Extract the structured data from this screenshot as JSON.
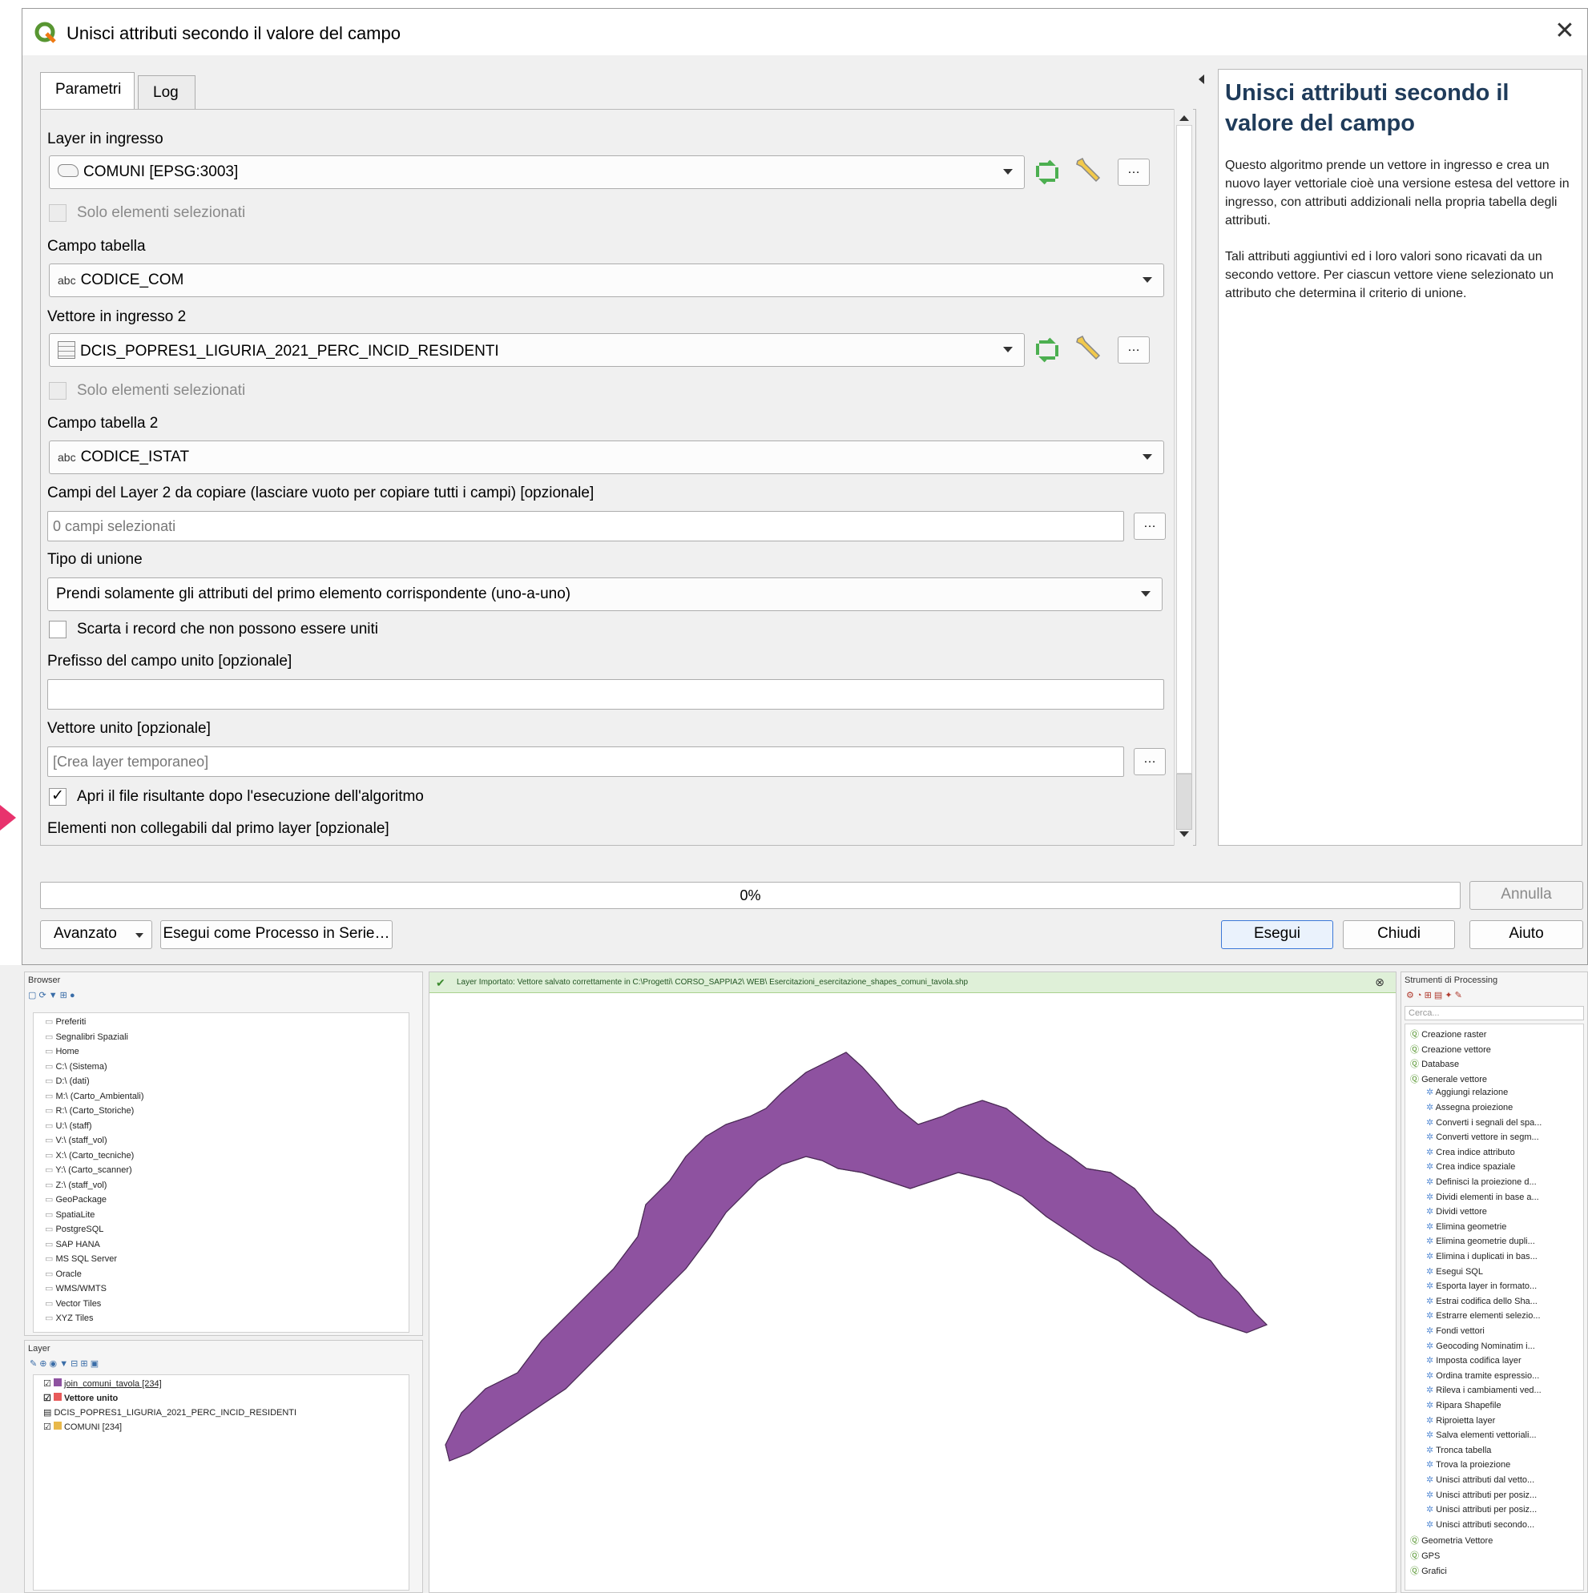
{
  "dialog": {
    "title": "Unisci attributi secondo il valore del campo",
    "close_glyph": "✕",
    "tabs": [
      "Parametri",
      "Log"
    ],
    "fields": {
      "input_layer_label": "Layer in ingresso",
      "input_layer_value": "COMUNI [EPSG:3003]",
      "selected_only_label": "Solo elementi selezionati",
      "table_field_label": "Campo tabella",
      "table_field_prefix": "abc",
      "table_field_value": "CODICE_COM",
      "input_layer2_label": "Vettore in ingresso 2",
      "input_layer2_value": "DCIS_POPRES1_LIGURIA_2021_PERC_INCID_RESIDENTI",
      "selected_only2_label": "Solo elementi selezionati",
      "table_field2_label": "Campo tabella 2",
      "table_field2_prefix": "abc",
      "table_field2_value": "CODICE_ISTAT",
      "fields_to_copy_label": "Campi del Layer 2 da copiare (lasciare vuoto per copiare tutti i campi) [opzionale]",
      "fields_to_copy_value": "0 campi selezionati",
      "join_type_label": "Tipo di unione",
      "join_type_value": "Prendi solamente gli attributi del primo elemento corrispondente (uno-a-uno)",
      "discard_label": "Scarta i record che non possono essere uniti",
      "prefix_label": "Prefisso del campo unito [opzionale]",
      "prefix_value": "",
      "joined_layer_label": "Vettore unito [opzionale]",
      "joined_layer_placeholder": "[Crea layer temporaneo]",
      "open_output_label": "Apri il file risultante dopo l'esecuzione dell'algoritmo",
      "open_output_checked": "✓",
      "unjoinable_label": "Elementi non collegabili dal primo layer [opzionale]",
      "ellipsis": "…"
    },
    "help": {
      "title": "Unisci attributi secondo il valore del campo",
      "p1": "Questo algoritmo prende un vettore in ingresso e crea un nuovo layer vettoriale cioè una versione estesa del vettore in ingresso, con attributi addizionali nella propria tabella degli attributi.",
      "p2": "Tali attributi aggiuntivi ed i loro valori sono ricavati da un secondo vettore. Per ciascun vettore viene selezionato un attributo che determina il criterio di unione."
    },
    "progress": {
      "value": 0,
      "label": "0%"
    },
    "buttons": {
      "cancel": "Annulla",
      "advanced": "Avanzato",
      "batch": "Esegui come Processo in Serie…",
      "run": "Esegui",
      "close": "Chiudi",
      "help": "Aiuto"
    }
  },
  "qgis": {
    "browser_title": "Browser",
    "browser_items": [
      "Preferiti",
      "Segnalibri Spaziali",
      "Home",
      "C:\\ (Sistema)",
      "D:\\ (dati)",
      "M:\\ (Carto_Ambientali)",
      "R:\\ (Carto_Storiche)",
      "U:\\ (staff)",
      "V:\\ (staff_vol)",
      "X:\\ (Carto_tecniche)",
      "Y:\\ (Carto_scanner)",
      "Z:\\ (staff_vol)",
      "GeoPackage",
      "SpatiaLite",
      "PostgreSQL",
      "SAP HANA",
      "MS SQL Server",
      "Oracle",
      "WMS/WMTS",
      "Vector Tiles",
      "XYZ Tiles"
    ],
    "layers_title": "Layer",
    "layer_items": [
      "join_comuni_tavola [234]",
      "Vettore unito",
      "DCIS_POPRES1_LIGURIA_2021_PERC_INCID_RESIDENTI",
      "COMUNI [234]"
    ],
    "message": "Layer Importato: Vettore salvato correttamente in C:\\Progetti\\ CORSO_SAPPIA2\\ WEB\\ Esercitazioni_esercitazione_shapes_comuni_tavola.shp",
    "tools_title": "Strumenti di Processing",
    "search_placeholder": "Cerca...",
    "tool_groups": [
      "Creazione raster",
      "Creazione vettore",
      "Database",
      "Generale vettore"
    ],
    "tool_items": [
      "Aggiungi relazione",
      "Assegna proiezione",
      "Converti i segnali del spa...",
      "Converti vettore in segm...",
      "Crea indice attributo",
      "Crea indice spaziale",
      "Definisci la proiezione d...",
      "Dividi elementi in base a...",
      "Dividi vettore",
      "Elimina geometrie",
      "Elimina geometrie dupli...",
      "Elimina i duplicati in bas...",
      "Esegui SQL",
      "Esporta layer in formato...",
      "Estrai codifica dello Sha...",
      "Estrarre elementi selezio...",
      "Fondi vettori",
      "Geocoding Nominatim i...",
      "Imposta codifica layer",
      "Ordina tramite espressio...",
      "Rileva i cambiamenti ved...",
      "Ripara Shapefile",
      "Riproietta layer",
      "Salva elementi vettoriali...",
      "Tronca tabella",
      "Trova la proiezione",
      "Unisci attributi dal vetto...",
      "Unisci attributi per posiz...",
      "Unisci attributi per posiz...",
      "Unisci attributi secondo..."
    ],
    "tool_groups_after": [
      "Geometria Vettore",
      "GPS",
      "Grafici"
    ]
  },
  "colors": {
    "map_fill": "#8e52a0",
    "map_stroke": "#4a2a55",
    "help_title": "#1f3b5a",
    "qgis_green": "#589632",
    "accent_marker": "#e8336d"
  }
}
